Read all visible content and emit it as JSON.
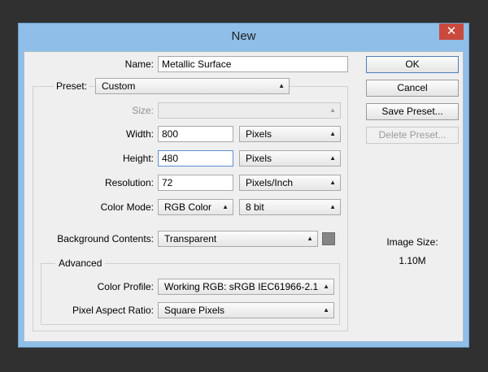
{
  "dialog": {
    "title": "New",
    "close_glyph": "✕",
    "name": {
      "label": "Name:",
      "value": "Metallic Surface"
    },
    "preset": {
      "label": "Preset:",
      "value": "Custom"
    },
    "size": {
      "label": "Size:",
      "value": ""
    },
    "width": {
      "label": "Width:",
      "value": "800",
      "unit": "Pixels"
    },
    "height": {
      "label": "Height:",
      "value": "480",
      "unit": "Pixels"
    },
    "resolution": {
      "label": "Resolution:",
      "value": "72",
      "unit": "Pixels/Inch"
    },
    "color_mode": {
      "label": "Color Mode:",
      "value": "RGB Color",
      "depth": "8 bit"
    },
    "background": {
      "label": "Background Contents:",
      "value": "Transparent",
      "swatch_color": "#858585"
    },
    "advanced": {
      "legend": "Advanced",
      "color_profile": {
        "label": "Color Profile:",
        "value": "Working RGB:  sRGB IEC61966-2.1"
      },
      "pixel_aspect": {
        "label": "Pixel Aspect Ratio:",
        "value": "Square Pixels"
      }
    },
    "buttons": {
      "ok": "OK",
      "cancel": "Cancel",
      "save_preset": "Save Preset...",
      "delete_preset": "Delete Preset..."
    },
    "image_size": {
      "label": "Image Size:",
      "value": "1.10M"
    }
  }
}
